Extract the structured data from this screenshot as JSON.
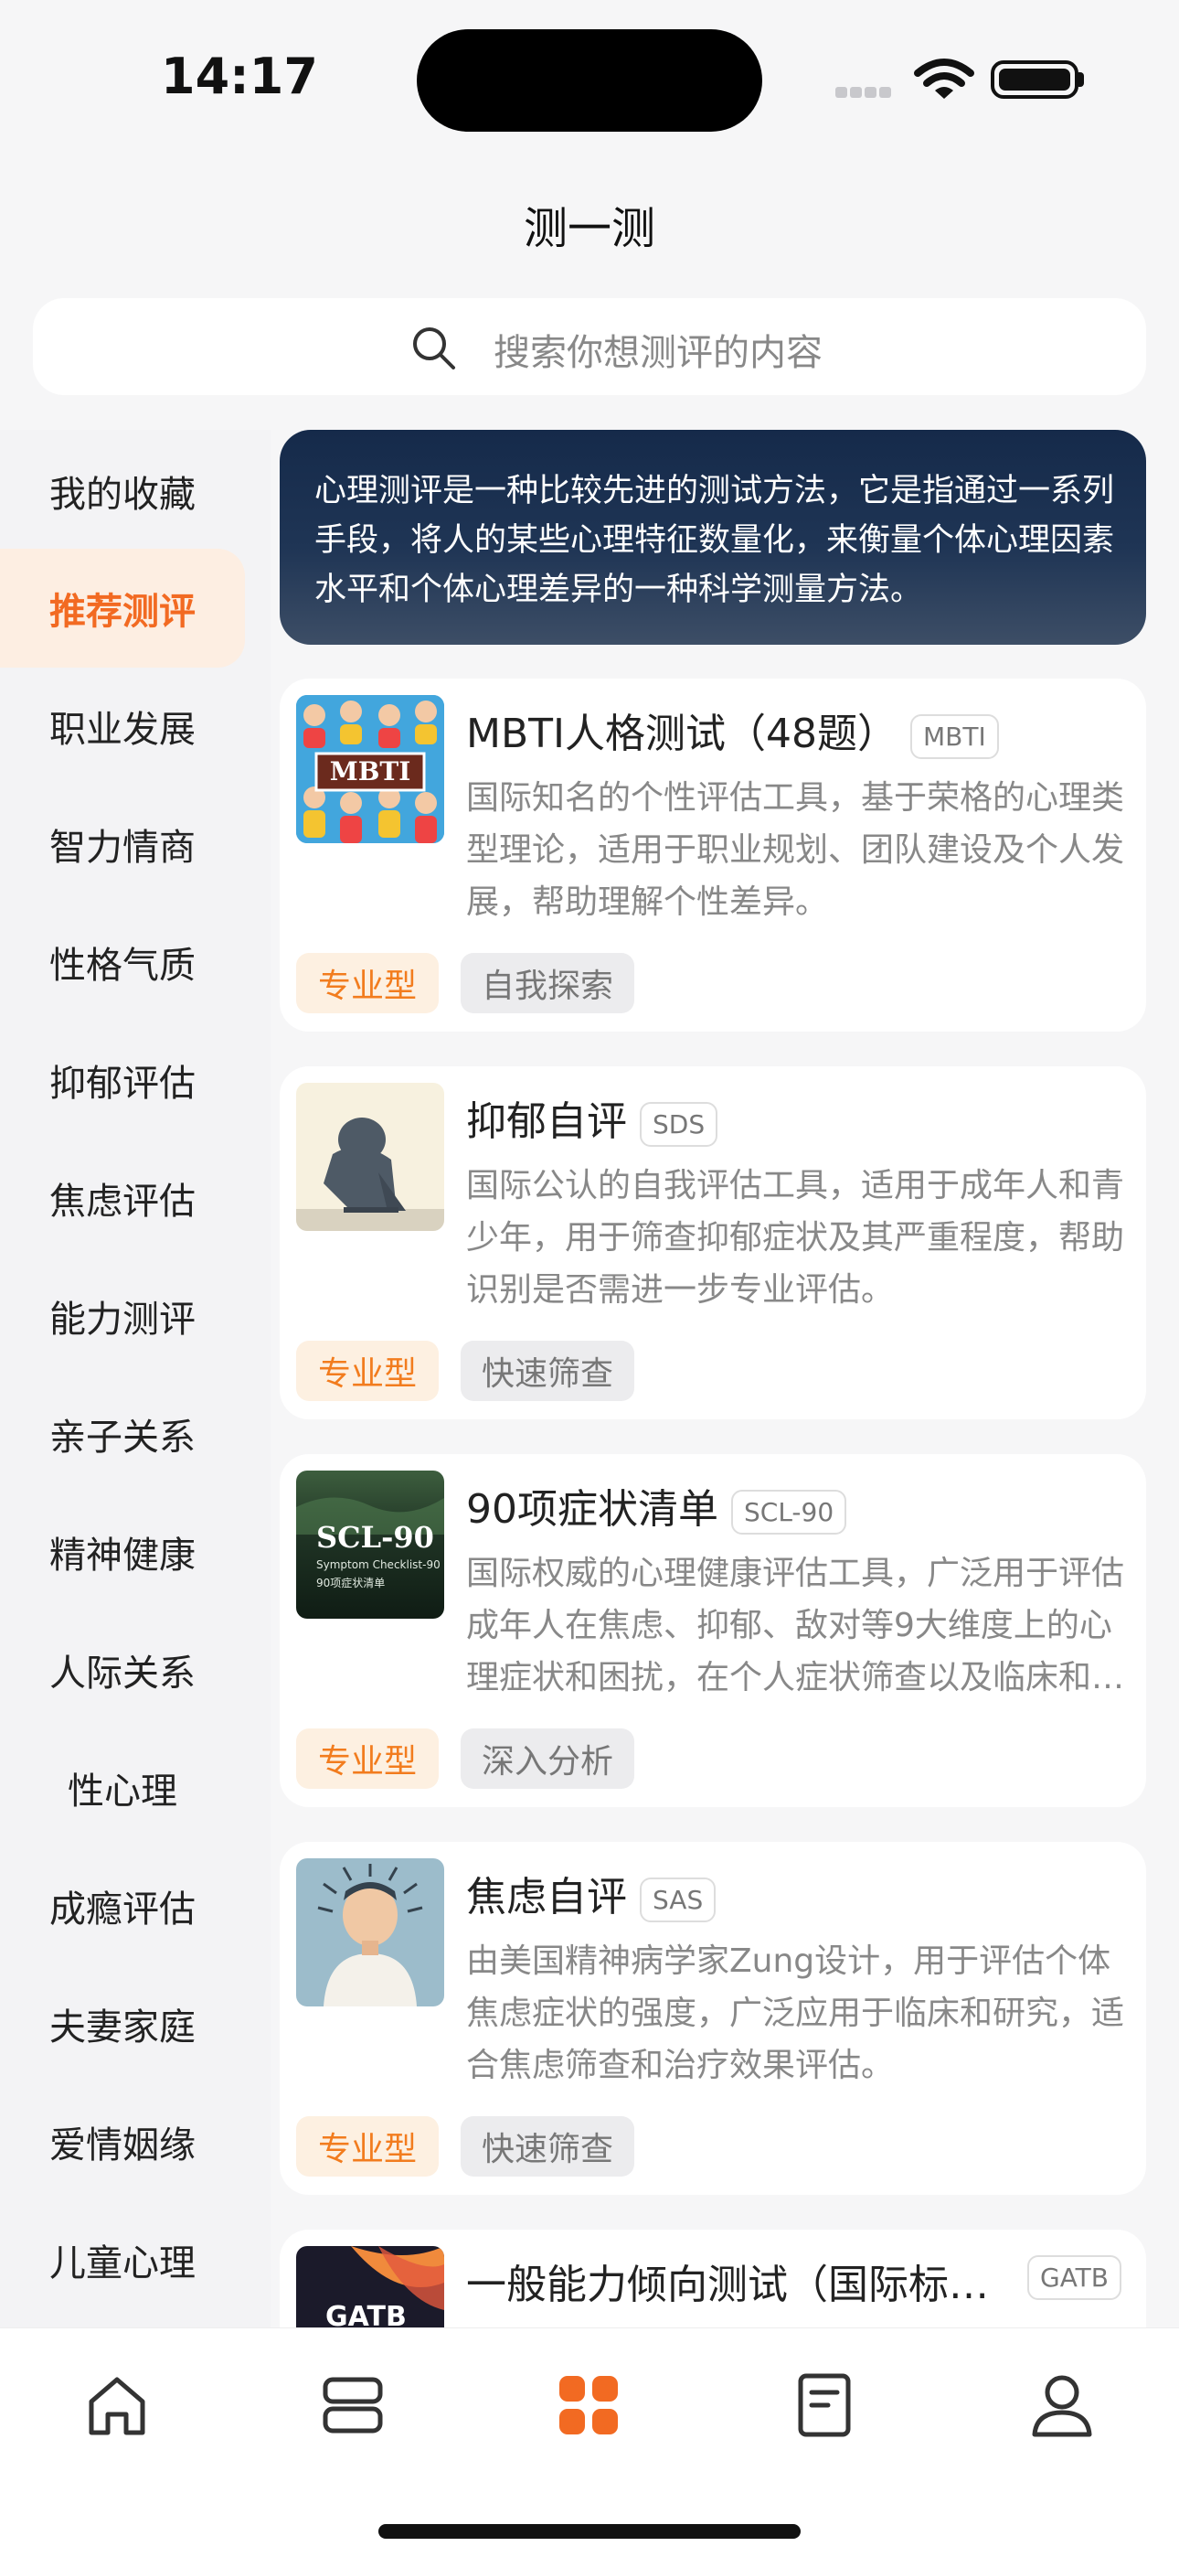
{
  "status": {
    "time": "14:17"
  },
  "nav": {
    "title": "测一测"
  },
  "search": {
    "placeholder": "搜索你想测评的内容"
  },
  "sidebar": {
    "items": [
      {
        "label": "我的收藏"
      },
      {
        "label": "推荐测评",
        "active": true
      },
      {
        "label": "职业发展"
      },
      {
        "label": "智力情商"
      },
      {
        "label": "性格气质"
      },
      {
        "label": "抑郁评估"
      },
      {
        "label": "焦虑评估"
      },
      {
        "label": "能力测评"
      },
      {
        "label": "亲子关系"
      },
      {
        "label": "精神健康"
      },
      {
        "label": "人际关系"
      },
      {
        "label": "性心理"
      },
      {
        "label": "成瘾评估"
      },
      {
        "label": "夫妻家庭"
      },
      {
        "label": "爱情姻缘"
      },
      {
        "label": "儿童心理"
      }
    ]
  },
  "intro": {
    "text": "心理测评是一种比较先进的测试方法，它是指通过一系列手段，将人的某些心理特征数量化，来衡量个体心理因素水平和个体心理差异的一种科学测量方法。"
  },
  "cards": [
    {
      "title": "MBTI人格测试（48题）",
      "code": "MBTI",
      "thumb_text": "MBTI",
      "desc": "国际知名的个性评估工具，基于荣格的心理类型理论，适用于职业规划、团队建设及个人发展，帮助理解个性差异。",
      "type_tag": "专业型",
      "cat_tag": "自我探索"
    },
    {
      "title": "抑郁自评",
      "code": "SDS",
      "desc": "国际公认的自我评估工具，适用于成年人和青少年，用于筛查抑郁症状及其严重程度，帮助识别是否需进一步专业评估。",
      "type_tag": "专业型",
      "cat_tag": "快速筛查"
    },
    {
      "title": "90项症状清单",
      "code": "SCL-90",
      "thumb_text": "SCL-90",
      "thumb_sub": "Symptom Checklist-90",
      "thumb_sub2": "90项症状清单",
      "desc": "国际权威的心理健康评估工具，广泛用于评估成年人在焦虑、抑郁、敌对等9大维度上的心理症状和困扰，在个人症状筛查以及临床和…",
      "type_tag": "专业型",
      "cat_tag": "深入分析"
    },
    {
      "title": "焦虑自评",
      "code": "SAS",
      "desc": "由美国精神病学家Zung设计，用于评估个体焦虑症状的强度，广泛应用于临床和研究，适合焦虑筛查和治疗效果评估。",
      "type_tag": "专业型",
      "cat_tag": "快速筛查"
    },
    {
      "title": "一般能力倾向测试（国际标…",
      "code": "GATB",
      "thumb_text": "GATB"
    }
  ],
  "tabs": [
    {
      "icon": "home-icon"
    },
    {
      "icon": "layers-icon"
    },
    {
      "icon": "grid-icon",
      "active": true
    },
    {
      "icon": "document-icon"
    },
    {
      "icon": "profile-icon"
    }
  ],
  "colors": {
    "accent": "#f26a22",
    "active_bg": "#fdeee2",
    "intro_bg": "#1f3555"
  }
}
